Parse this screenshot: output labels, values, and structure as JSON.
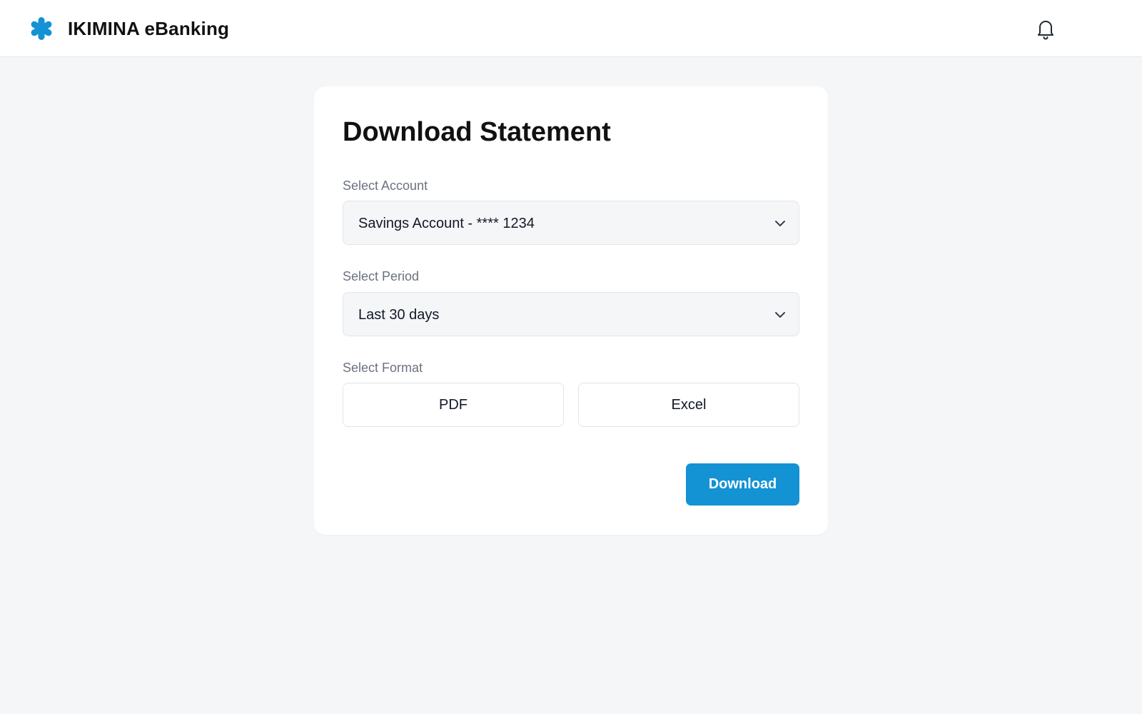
{
  "header": {
    "app_title": "IKIMINA eBanking",
    "logo_icon": "asterisk-icon",
    "notification_icon": "bell-icon",
    "brand_color": "#1392d4"
  },
  "statement_form": {
    "title": "Download Statement",
    "account": {
      "label": "Select Account",
      "value": "Savings Account - **** 1234"
    },
    "period": {
      "label": "Select Period",
      "value": "Last 30 days"
    },
    "format": {
      "label": "Select Format",
      "options": [
        "PDF",
        "Excel"
      ]
    },
    "submit_label": "Download"
  }
}
